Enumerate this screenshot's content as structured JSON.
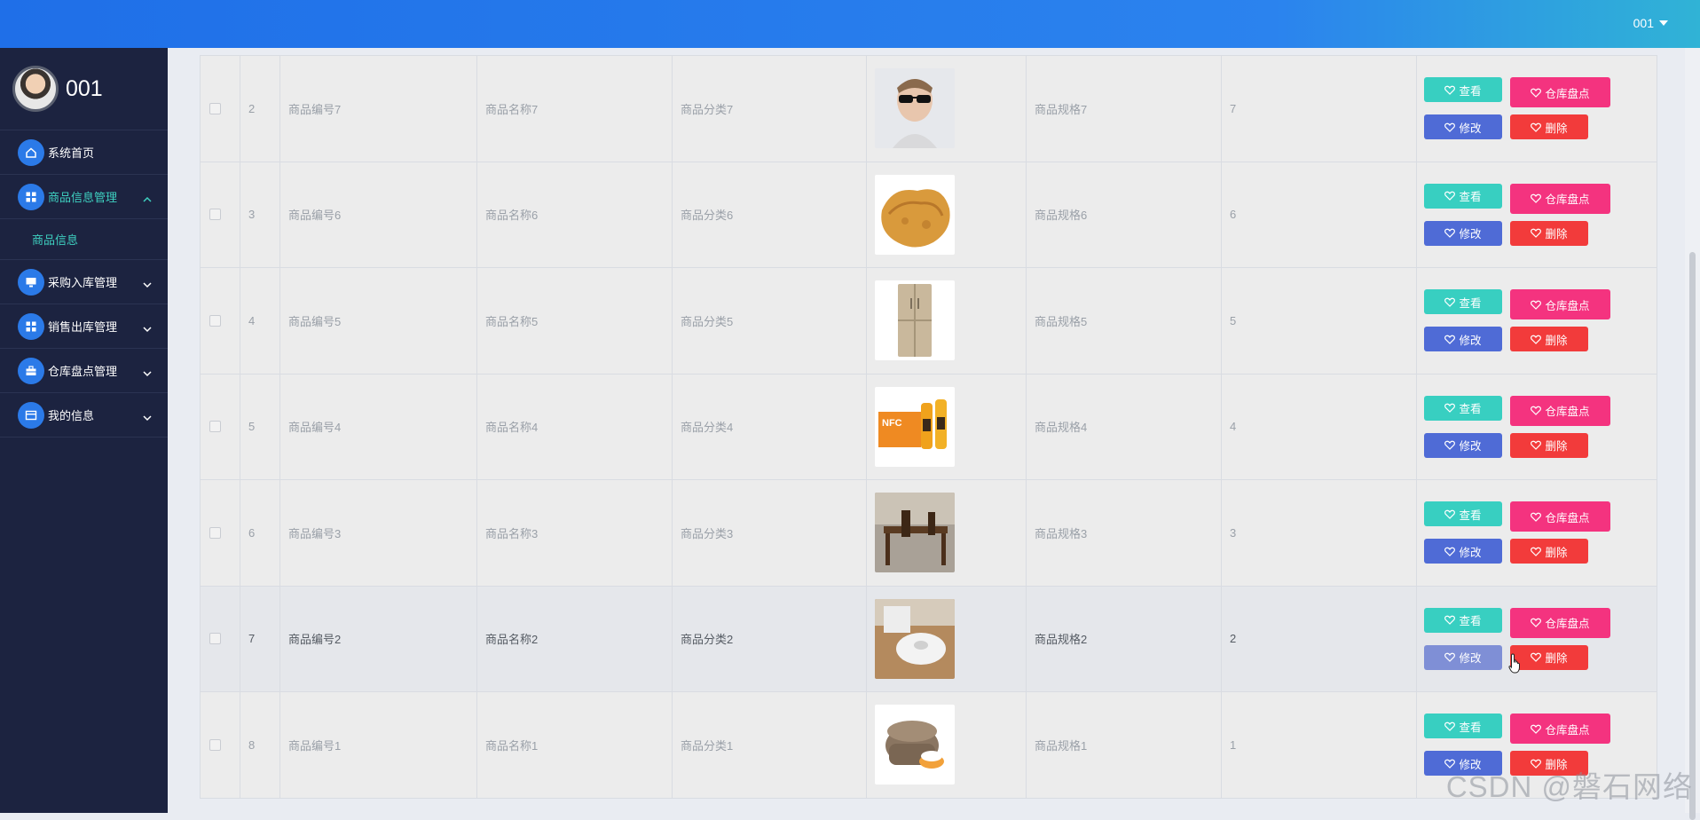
{
  "header": {
    "user_menu_label": "001"
  },
  "sidebar": {
    "profile_name": "001",
    "items": [
      {
        "label": "系统首页",
        "icon": "home-icon"
      },
      {
        "label": "商品信息管理",
        "icon": "grid-icon",
        "expanded": true
      },
      {
        "label": "采购入库管理",
        "icon": "monitor-icon"
      },
      {
        "label": "销售出库管理",
        "icon": "grid-icon"
      },
      {
        "label": "仓库盘点管理",
        "icon": "briefcase-icon"
      },
      {
        "label": "我的信息",
        "icon": "card-icon"
      }
    ],
    "submenu": {
      "label": "商品信息"
    }
  },
  "buttons": {
    "view": "查看",
    "stocktake": "仓库盘点",
    "edit": "修改",
    "delete": "删除"
  },
  "table": {
    "rows": [
      {
        "index": "2",
        "code": "商品编号7",
        "name": "商品名称7",
        "category": "商品分类7",
        "image": "sunglasses-man-photo",
        "spec": "商品规格7",
        "qty": "7"
      },
      {
        "index": "3",
        "code": "商品编号6",
        "name": "商品名称6",
        "category": "商品分类6",
        "image": "fried-chicken-photo",
        "spec": "商品规格6",
        "qty": "6"
      },
      {
        "index": "4",
        "code": "商品编号5",
        "name": "商品名称5",
        "category": "商品分类5",
        "image": "refrigerator-photo",
        "spec": "商品规格5",
        "qty": "5"
      },
      {
        "index": "5",
        "code": "商品编号4",
        "name": "商品名称4",
        "category": "商品分类4",
        "image": "orange-juice-photo",
        "spec": "商品规格4",
        "qty": "4"
      },
      {
        "index": "6",
        "code": "商品编号3",
        "name": "商品名称3",
        "category": "商品分类3",
        "image": "wooden-desk-photo",
        "spec": "商品规格3",
        "qty": "3"
      },
      {
        "index": "7",
        "code": "商品编号2",
        "name": "商品名称2",
        "category": "商品分类2",
        "image": "robot-vacuum-photo",
        "spec": "商品规格2",
        "qty": "2",
        "hovered": true
      },
      {
        "index": "8",
        "code": "商品编号1",
        "name": "商品名称1",
        "category": "商品分类1",
        "image": "rice-cooker-photo",
        "spec": "商品规格1",
        "qty": "1"
      }
    ]
  },
  "watermark": "CSDN @磐石网络",
  "colors": {
    "header_start": "#1f6fe8",
    "sidebar_bg": "#1c2340",
    "active_menu": "#3ed0c0",
    "view_button": "#38cfc1",
    "stocktake_button": "#f4337f",
    "edit_button": "#4f6bd6",
    "delete_button": "#f23b3b"
  }
}
